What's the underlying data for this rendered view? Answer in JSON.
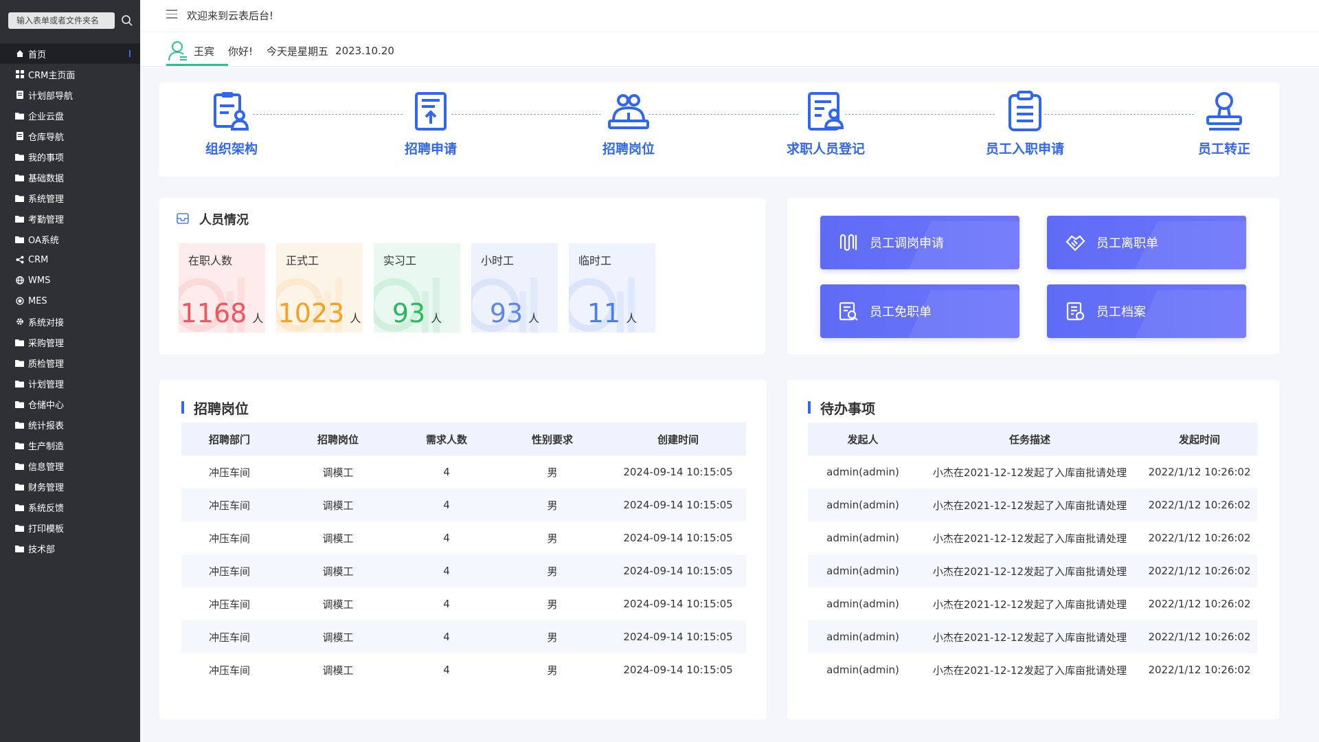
{
  "sidebar": {
    "search_placeholder": "输入表单或者文件夹名",
    "items": [
      {
        "label": "首页",
        "icon": "home-icon"
      },
      {
        "label": "CRM主页面",
        "icon": "grid-icon"
      },
      {
        "label": "计划部导航",
        "icon": "document-icon"
      },
      {
        "label": "企业云盘",
        "icon": "folder-icon"
      },
      {
        "label": "仓库导航",
        "icon": "document-icon"
      },
      {
        "label": "我的事项",
        "icon": "folder-icon"
      },
      {
        "label": "基础数据",
        "icon": "folder-icon"
      },
      {
        "label": "系统管理",
        "icon": "folder-icon"
      },
      {
        "label": "考勤管理",
        "icon": "folder-icon"
      },
      {
        "label": "OA系统",
        "icon": "folder-icon"
      },
      {
        "label": "CRM",
        "icon": "share-icon"
      },
      {
        "label": "WMS",
        "icon": "globe-icon"
      },
      {
        "label": "MES",
        "icon": "chip-icon"
      },
      {
        "label": "系统对接",
        "icon": "gear-icon"
      },
      {
        "label": "采购管理",
        "icon": "folder-icon"
      },
      {
        "label": "质检管理",
        "icon": "folder-icon"
      },
      {
        "label": "计划管理",
        "icon": "folder-icon"
      },
      {
        "label": "仓储中心",
        "icon": "folder-icon"
      },
      {
        "label": "统计报表",
        "icon": "folder-icon"
      },
      {
        "label": "生产制造",
        "icon": "folder-icon"
      },
      {
        "label": "信息管理",
        "icon": "folder-icon"
      },
      {
        "label": "财务管理",
        "icon": "folder-icon"
      },
      {
        "label": "系统反馈",
        "icon": "folder-icon"
      },
      {
        "label": "打印模板",
        "icon": "folder-icon"
      },
      {
        "label": "技术部",
        "icon": "folder-icon"
      }
    ]
  },
  "header": {
    "welcome": "欢迎来到云表后台!",
    "user_name": "王宾",
    "greeting": "你好!",
    "weekday": "今天是星期五",
    "date": "2023.10.20"
  },
  "nav": {
    "items": [
      {
        "label": "组织架构",
        "icon": "org-chart-icon"
      },
      {
        "label": "招聘申请",
        "icon": "upload-document-icon"
      },
      {
        "label": "招聘岗位",
        "icon": "group-icon"
      },
      {
        "label": "求职人员登记",
        "icon": "resume-icon"
      },
      {
        "label": "员工入职申请",
        "icon": "clipboard-icon"
      },
      {
        "label": "员工转正",
        "icon": "stamp-icon"
      }
    ]
  },
  "personnel": {
    "title": "人员情况",
    "stats": [
      {
        "label": "在职人数",
        "value": "1168",
        "unit": "人",
        "color": "#f0555e",
        "bg": "#fdeceb"
      },
      {
        "label": "正式工",
        "value": "1023",
        "unit": "人",
        "color": "#f5a020",
        "bg": "#fdf4e8"
      },
      {
        "label": "实习工",
        "value": "93",
        "unit": "人",
        "color": "#27b95a",
        "bg": "#e9f8f1"
      },
      {
        "label": "小时工",
        "value": "93",
        "unit": "人",
        "color": "#5d87e8",
        "bg": "#edf2fc"
      },
      {
        "label": "临时工",
        "value": "11",
        "unit": "人",
        "color": "#4a7df0",
        "bg": "#eef3fd"
      }
    ]
  },
  "actions": {
    "items": [
      {
        "label": "员工调岗申请",
        "icon": "transfer-icon"
      },
      {
        "label": "员工离职单",
        "icon": "handshake-icon"
      },
      {
        "label": "员工免职单",
        "icon": "search-document-icon"
      },
      {
        "label": "员工档案",
        "icon": "archive-icon"
      }
    ]
  },
  "recruit": {
    "title": "招聘岗位",
    "columns": [
      "招聘部门",
      "招聘岗位",
      "需求人数",
      "性别要求",
      "创建时间"
    ],
    "rows": [
      [
        "冲压车间",
        "调模工",
        "4",
        "男",
        "2024-09-14 10:15:05"
      ],
      [
        "冲压车间",
        "调模工",
        "4",
        "男",
        "2024-09-14 10:15:05"
      ],
      [
        "冲压车间",
        "调模工",
        "4",
        "男",
        "2024-09-14 10:15:05"
      ],
      [
        "冲压车间",
        "调模工",
        "4",
        "男",
        "2024-09-14 10:15:05"
      ],
      [
        "冲压车间",
        "调模工",
        "4",
        "男",
        "2024-09-14 10:15:05"
      ],
      [
        "冲压车间",
        "调模工",
        "4",
        "男",
        "2024-09-14 10:15:05"
      ],
      [
        "冲压车间",
        "调模工",
        "4",
        "男",
        "2024-09-14 10:15:05"
      ]
    ]
  },
  "todo": {
    "title": "待办事项",
    "columns": [
      "发起人",
      "任务描述",
      "发起时间"
    ],
    "rows": [
      [
        "admin(admin)",
        "小杰在2021-12-12发起了入库亩批请处理",
        "2022/1/12 10:26:02"
      ],
      [
        "admin(admin)",
        "小杰在2021-12-12发起了入库亩批请处理",
        "2022/1/12 10:26:02"
      ],
      [
        "admin(admin)",
        "小杰在2021-12-12发起了入库亩批请处理",
        "2022/1/12 10:26:02"
      ],
      [
        "admin(admin)",
        "小杰在2021-12-12发起了入库亩批请处理",
        "2022/1/12 10:26:02"
      ],
      [
        "admin(admin)",
        "小杰在2021-12-12发起了入库亩批请处理",
        "2022/1/12 10:26:02"
      ],
      [
        "admin(admin)",
        "小杰在2021-12-12发起了入库亩批请处理",
        "2022/1/12 10:26:02"
      ],
      [
        "admin(admin)",
        "小杰在2021-12-12发起了入库亩批请处理",
        "2022/1/12 10:26:02"
      ]
    ]
  },
  "colors": {
    "accent": "#2f67f4",
    "sidebar_bg": "#2f3035",
    "action_button": "#6470f7",
    "user_tab_green": "#2bbf8d"
  }
}
